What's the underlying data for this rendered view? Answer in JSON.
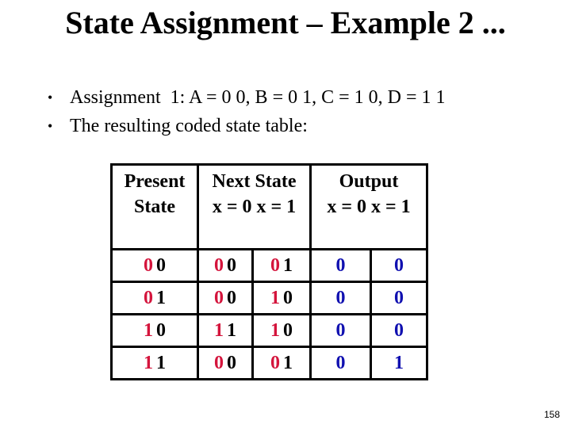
{
  "slide": {
    "title": "State Assignment – Example 2 ...",
    "bullets": [
      "Assignment  1: A = 0 0, B = 0 1, C = 1 0, D = 1 1",
      "The resulting coded state table:"
    ],
    "bullet_glyph": "•",
    "page_number": "158"
  },
  "table": {
    "headers": {
      "present_line1": "Present",
      "present_line2": "State",
      "next_line1": "Next State",
      "next_line2": "x = 0 x = 1",
      "output_line1": "Output",
      "output_line2": "x = 0 x = 1"
    },
    "rows": [
      {
        "present": [
          "0",
          "0"
        ],
        "next_x0": [
          "0",
          "0"
        ],
        "next_x1": [
          "0",
          "1"
        ],
        "out_x0": "0",
        "out_x1": "0"
      },
      {
        "present": [
          "0",
          "1"
        ],
        "next_x0": [
          "0",
          "0"
        ],
        "next_x1": [
          "1",
          "0"
        ],
        "out_x0": "0",
        "out_x1": "0"
      },
      {
        "present": [
          "1",
          "0"
        ],
        "next_x0": [
          "1",
          "1"
        ],
        "next_x1": [
          "1",
          "0"
        ],
        "out_x0": "0",
        "out_x1": "0"
      },
      {
        "present": [
          "1",
          "1"
        ],
        "next_x0": [
          "0",
          "0"
        ],
        "next_x1": [
          "0",
          "1"
        ],
        "out_x0": "0",
        "out_x1": "1"
      }
    ],
    "colors": {
      "first_bit": "#d4143c",
      "second_bit": "#000000",
      "output": "#1010b0"
    }
  }
}
